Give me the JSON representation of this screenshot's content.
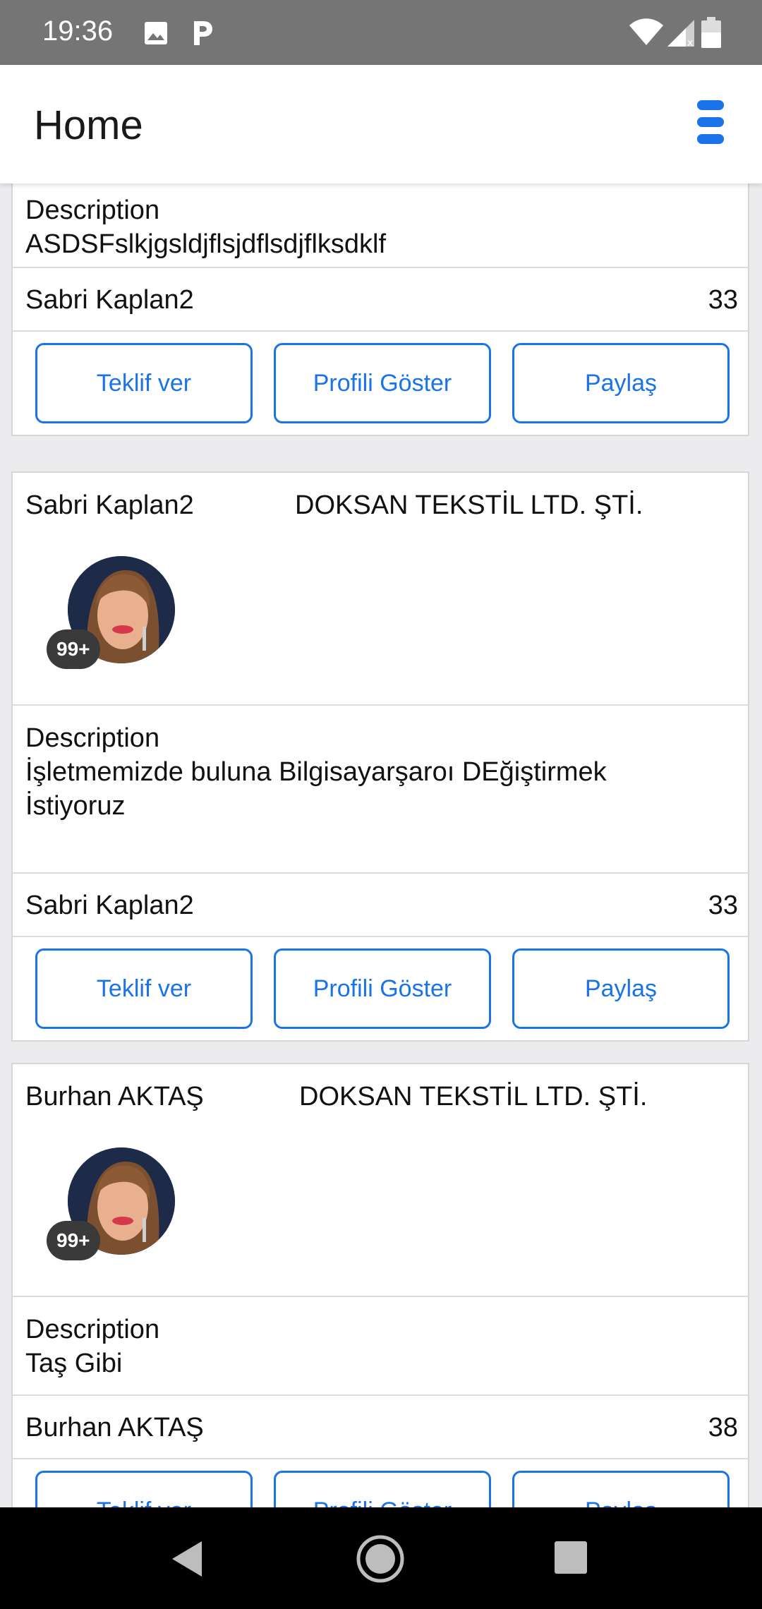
{
  "status_bar": {
    "time": "19:36"
  },
  "app_bar": {
    "title": "Home"
  },
  "top_card": {
    "description_label": "Description",
    "description_text": "ASDSFslkjgsldjflsjdflsdjflksdklf",
    "owner_name": "Sabri Kaplan2",
    "count": "33",
    "buttons": {
      "offer": "Teklif ver",
      "profile": "Profili Göster",
      "share": "Paylaş"
    }
  },
  "cards": [
    {
      "owner_name": "Sabri Kaplan2",
      "company": "DOKSAN TEKSTİL LTD. ŞTİ.",
      "badge": "99+",
      "description_label": "Description",
      "description_text": "İşletmemizde buluna Bilgisayarşarоı DEğiştirmek İstiyoruz",
      "footer_name": "Sabri Kaplan2",
      "count": "33",
      "buttons": {
        "offer": "Teklif ver",
        "profile": "Profili Göster",
        "share": "Paylaş"
      }
    },
    {
      "owner_name": "Burhan AKTAŞ",
      "company": "DOKSAN TEKSTİL LTD. ŞTİ.",
      "badge": "99+",
      "description_label": "Description",
      "description_text": "Taş Gibi",
      "footer_name": "Burhan AKTAŞ",
      "count": "38",
      "buttons": {
        "offer": "Teklif ver",
        "profile": "Profili Göster",
        "share": "Paylaş"
      }
    }
  ],
  "icons": {
    "status_left": [
      "image-icon",
      "parking-icon"
    ],
    "status_right": [
      "wifi-icon",
      "signal-icon",
      "battery-icon"
    ],
    "app_bar": "menu-icon",
    "nav": [
      "back-icon",
      "home-icon",
      "recents-icon"
    ]
  },
  "colors": {
    "accent": "#1a73e8",
    "status_bar": "#757575",
    "badge": "#3a3a3a"
  }
}
